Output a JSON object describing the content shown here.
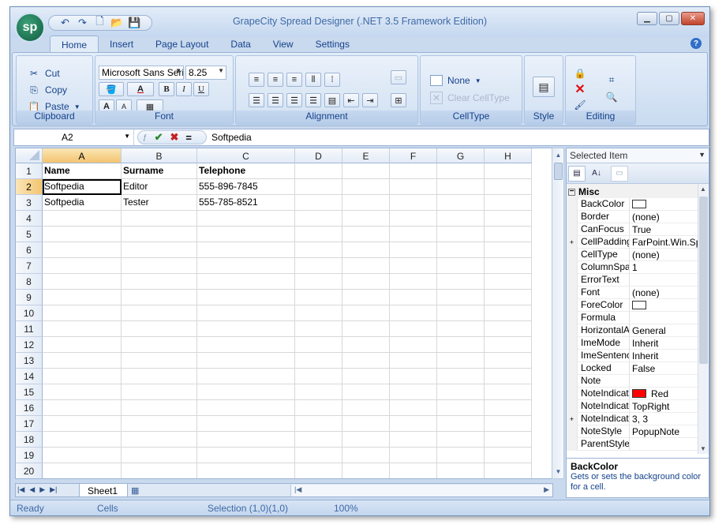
{
  "app": {
    "title": "GrapeCity Spread Designer (.NET 3.5 Framework Edition)",
    "logo_text": "sp"
  },
  "tabs": [
    "Home",
    "Insert",
    "Page Layout",
    "Data",
    "View",
    "Settings"
  ],
  "ribbon": {
    "clipboard": {
      "label": "Clipboard",
      "cut": "Cut",
      "copy": "Copy",
      "paste": "Paste"
    },
    "font": {
      "label": "Font",
      "family": "Microsoft Sans Seri",
      "size": "8.25",
      "bold": "B",
      "italic": "I",
      "underline": "U",
      "grow": "A",
      "shrink": "A"
    },
    "alignment": {
      "label": "Alignment"
    },
    "celltype": {
      "label": "CellType",
      "none": "None",
      "clear": "Clear CellType"
    },
    "style": {
      "label": "Style"
    },
    "editing": {
      "label": "Editing"
    }
  },
  "formula_bar": {
    "name_box": "A2",
    "value": "Softpedia",
    "equals": "="
  },
  "grid": {
    "columns": [
      "A",
      "B",
      "C",
      "D",
      "E",
      "F",
      "G",
      "H"
    ],
    "selected_column": "A",
    "rows": [
      {
        "num": "1",
        "cells": [
          "Name",
          "Surname",
          "Telephone",
          "",
          "",
          "",
          "",
          ""
        ]
      },
      {
        "num": "2",
        "cells": [
          "Softpedia",
          "Editor",
          "555-896-7845",
          "",
          "",
          "",
          "",
          ""
        ]
      },
      {
        "num": "3",
        "cells": [
          "Softpedia",
          "Tester",
          "555-785-8521",
          "",
          "",
          "",
          "",
          ""
        ]
      },
      {
        "num": "4",
        "cells": [
          "",
          "",
          "",
          "",
          "",
          "",
          "",
          ""
        ]
      },
      {
        "num": "5",
        "cells": [
          "",
          "",
          "",
          "",
          "",
          "",
          "",
          ""
        ]
      },
      {
        "num": "6",
        "cells": [
          "",
          "",
          "",
          "",
          "",
          "",
          "",
          ""
        ]
      },
      {
        "num": "7",
        "cells": [
          "",
          "",
          "",
          "",
          "",
          "",
          "",
          ""
        ]
      },
      {
        "num": "8",
        "cells": [
          "",
          "",
          "",
          "",
          "",
          "",
          "",
          ""
        ]
      },
      {
        "num": "9",
        "cells": [
          "",
          "",
          "",
          "",
          "",
          "",
          "",
          ""
        ]
      },
      {
        "num": "10",
        "cells": [
          "",
          "",
          "",
          "",
          "",
          "",
          "",
          ""
        ]
      },
      {
        "num": "11",
        "cells": [
          "",
          "",
          "",
          "",
          "",
          "",
          "",
          ""
        ]
      },
      {
        "num": "12",
        "cells": [
          "",
          "",
          "",
          "",
          "",
          "",
          "",
          ""
        ]
      },
      {
        "num": "13",
        "cells": [
          "",
          "",
          "",
          "",
          "",
          "",
          "",
          ""
        ]
      },
      {
        "num": "14",
        "cells": [
          "",
          "",
          "",
          "",
          "",
          "",
          "",
          ""
        ]
      },
      {
        "num": "15",
        "cells": [
          "",
          "",
          "",
          "",
          "",
          "",
          "",
          ""
        ]
      },
      {
        "num": "16",
        "cells": [
          "",
          "",
          "",
          "",
          "",
          "",
          "",
          ""
        ]
      },
      {
        "num": "17",
        "cells": [
          "",
          "",
          "",
          "",
          "",
          "",
          "",
          ""
        ]
      },
      {
        "num": "18",
        "cells": [
          "",
          "",
          "",
          "",
          "",
          "",
          "",
          ""
        ]
      },
      {
        "num": "19",
        "cells": [
          "",
          "",
          "",
          "",
          "",
          "",
          "",
          ""
        ]
      },
      {
        "num": "20",
        "cells": [
          "",
          "",
          "",
          "",
          "",
          "",
          "",
          ""
        ]
      }
    ]
  },
  "sheet": {
    "tab": "Sheet1"
  },
  "status": {
    "ready": "Ready",
    "mode": "Cells",
    "selection": "Selection (1,0)(1,0)",
    "zoom": "100%"
  },
  "properties": {
    "selected_item": "Selected Item",
    "category": "Misc",
    "items": [
      {
        "name": "BackColor",
        "value": "",
        "swatch": "#ffffff",
        "expand": ""
      },
      {
        "name": "Border",
        "value": "(none)",
        "swatch": "",
        "expand": ""
      },
      {
        "name": "CanFocus",
        "value": "True",
        "swatch": "",
        "expand": ""
      },
      {
        "name": "CellPadding",
        "value": "FarPoint.Win.Sp",
        "swatch": "",
        "expand": "+"
      },
      {
        "name": "CellType",
        "value": "(none)",
        "swatch": "",
        "expand": ""
      },
      {
        "name": "ColumnSpan",
        "value": "1",
        "swatch": "",
        "expand": ""
      },
      {
        "name": "ErrorText",
        "value": "",
        "swatch": "",
        "expand": ""
      },
      {
        "name": "Font",
        "value": "(none)",
        "swatch": "",
        "expand": ""
      },
      {
        "name": "ForeColor",
        "value": "",
        "swatch": "#ffffff",
        "expand": ""
      },
      {
        "name": "Formula",
        "value": "",
        "swatch": "",
        "expand": ""
      },
      {
        "name": "HorizontalAlig",
        "value": "General",
        "swatch": "",
        "expand": ""
      },
      {
        "name": "ImeMode",
        "value": "Inherit",
        "swatch": "",
        "expand": ""
      },
      {
        "name": "ImeSentence",
        "value": "Inherit",
        "swatch": "",
        "expand": ""
      },
      {
        "name": "Locked",
        "value": "False",
        "swatch": "",
        "expand": ""
      },
      {
        "name": "Note",
        "value": "",
        "swatch": "",
        "expand": ""
      },
      {
        "name": "NoteIndicato",
        "value": "Red",
        "swatch": "#ff0000",
        "expand": ""
      },
      {
        "name": "NoteIndicato",
        "value": "TopRight",
        "swatch": "",
        "expand": ""
      },
      {
        "name": "NoteIndicato",
        "value": "3, 3",
        "swatch": "",
        "expand": "+"
      },
      {
        "name": "NoteStyle",
        "value": "PopupNote",
        "swatch": "",
        "expand": ""
      },
      {
        "name": "ParentStyleN",
        "value": "",
        "swatch": "",
        "expand": ""
      }
    ],
    "desc_title": "BackColor",
    "desc_text": "Gets or sets the background color for a cell."
  }
}
